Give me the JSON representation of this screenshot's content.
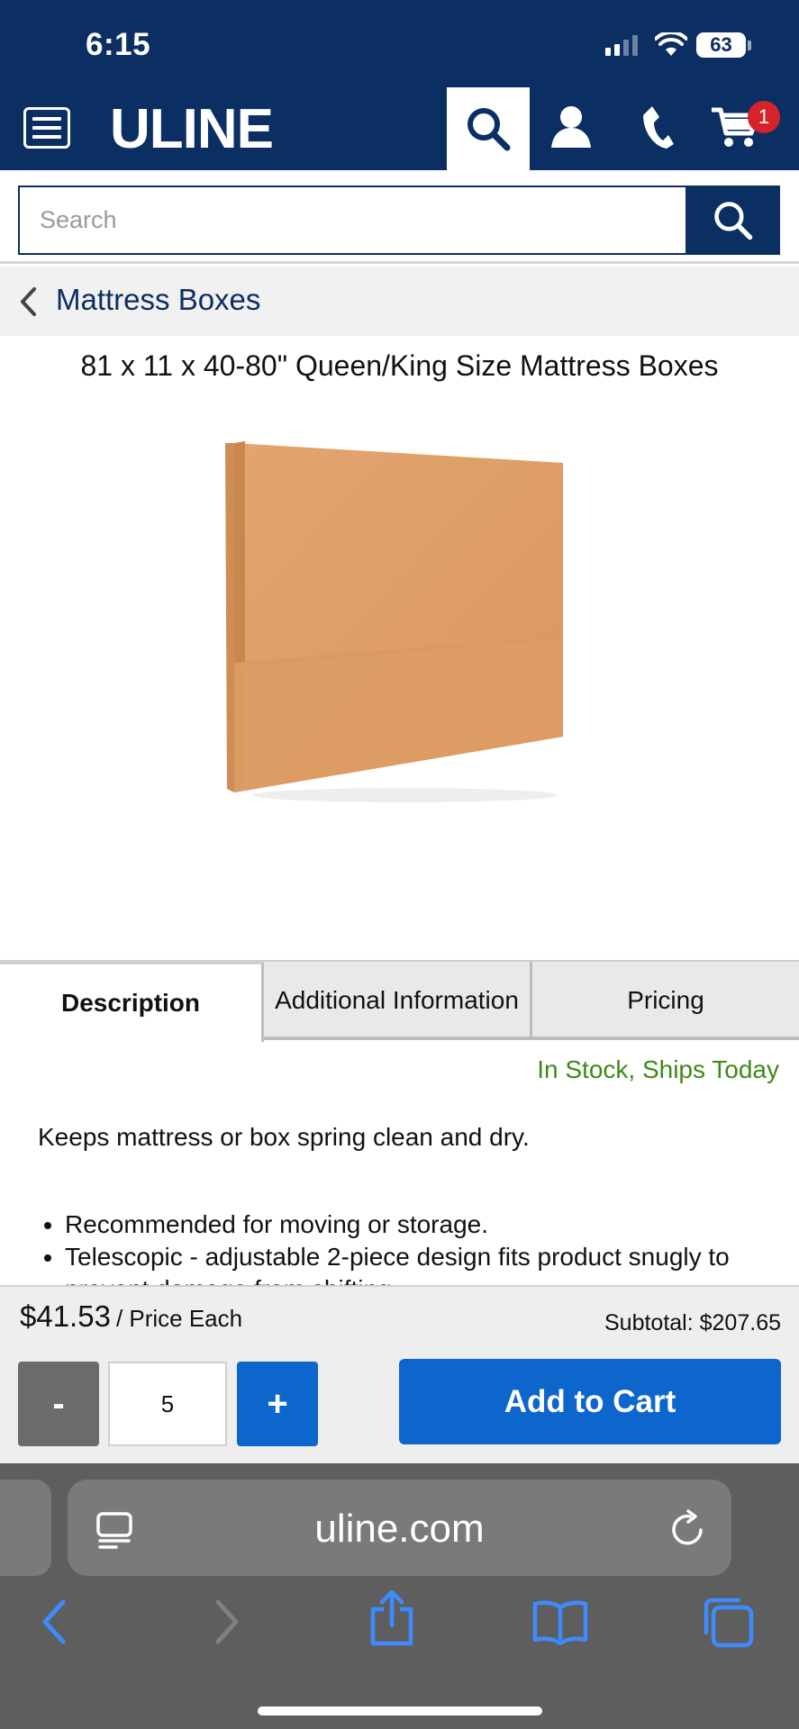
{
  "status": {
    "time": "6:15",
    "battery": "63"
  },
  "header": {
    "logo": "ULINE",
    "cart_count": "1"
  },
  "search": {
    "placeholder": "Search"
  },
  "breadcrumb": {
    "label": "Mattress Boxes"
  },
  "product": {
    "title": "81 x 11 x 40-80\" Queen/King Size Mattress Boxes"
  },
  "tabs": [
    {
      "label": "Description",
      "active": true
    },
    {
      "label": "Additional Information",
      "active": false
    },
    {
      "label": "Pricing",
      "active": false
    }
  ],
  "availability": "In Stock, Ships Today",
  "description": {
    "lead": "Keeps mattress or box spring clean and dry.",
    "bullets": [
      "Recommended for moving or storage.",
      "Telescopic - adjustable 2-piece design fits product snugly to prevent damage from shifting."
    ]
  },
  "purchase": {
    "price": "$41.53",
    "price_unit": "/ Price Each",
    "subtotal": "Subtotal: $207.65",
    "minus_label": "-",
    "plus_label": "+",
    "quantity": "5",
    "add_to_cart": "Add to Cart"
  },
  "browser": {
    "url": "uline.com"
  },
  "colors": {
    "brand_navy": "#0b2f63",
    "action_blue": "#0c66cc",
    "stock_green": "#3f8a17",
    "badge_red": "#d5232a"
  }
}
